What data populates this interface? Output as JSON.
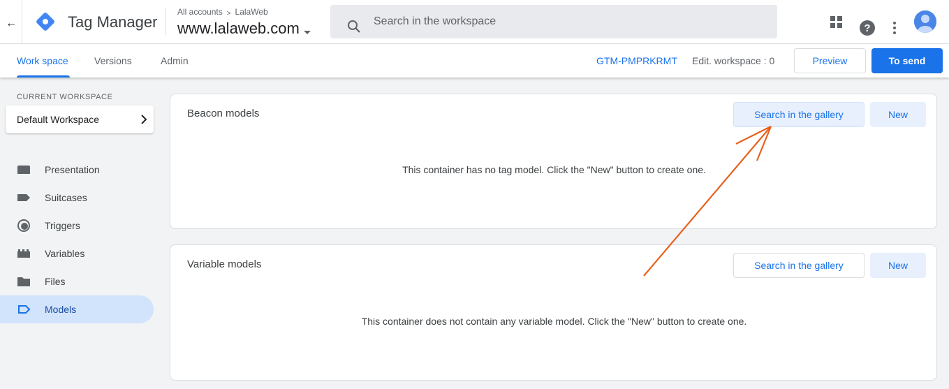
{
  "header": {
    "back_icon": "arrow-back-icon",
    "product_name": "Tag Manager",
    "breadcrumb_accounts": "All accounts",
    "breadcrumb_separator": ">",
    "breadcrumb_account": "LalaWeb",
    "container_name": "www.lalaweb.com",
    "search_placeholder": "Search in the workspace",
    "help_label": "?"
  },
  "subbar": {
    "tabs": [
      {
        "label": "Work space",
        "active": true
      },
      {
        "label": "Versions",
        "active": false
      },
      {
        "label": "Admin",
        "active": false
      }
    ],
    "container_id": "GTM-PMPRKRMT",
    "edit_workspace": "Edit. workspace : 0",
    "preview_label": "Preview",
    "send_label": "To send"
  },
  "sidebar": {
    "workspace_label": "CURRENT WORKSPACE",
    "workspace_name": "Default Workspace",
    "items": [
      {
        "label": "Presentation",
        "icon": "briefcase-icon",
        "active": false
      },
      {
        "label": "Suitcases",
        "icon": "tag-icon",
        "active": false
      },
      {
        "label": "Triggers",
        "icon": "trigger-icon",
        "active": false
      },
      {
        "label": "Variables",
        "icon": "variables-icon",
        "active": false
      },
      {
        "label": "Files",
        "icon": "folder-icon",
        "active": false
      },
      {
        "label": "Models",
        "icon": "template-icon",
        "active": true
      }
    ]
  },
  "panels": {
    "beacon": {
      "title": "Beacon models",
      "gallery_label": "Search in the gallery",
      "new_label": "New",
      "empty_text": "This container has no tag model. Click the \"New\" button to create one."
    },
    "variable": {
      "title": "Variable models",
      "gallery_label": "Search in the gallery",
      "new_label": "New",
      "empty_text": "This container does not contain any variable model. Click the \"New\" button to create one."
    }
  },
  "colors": {
    "accent": "#1a73e8",
    "annotation_arrow": "#e8601c",
    "active_nav_bg": "#d2e3fc"
  }
}
